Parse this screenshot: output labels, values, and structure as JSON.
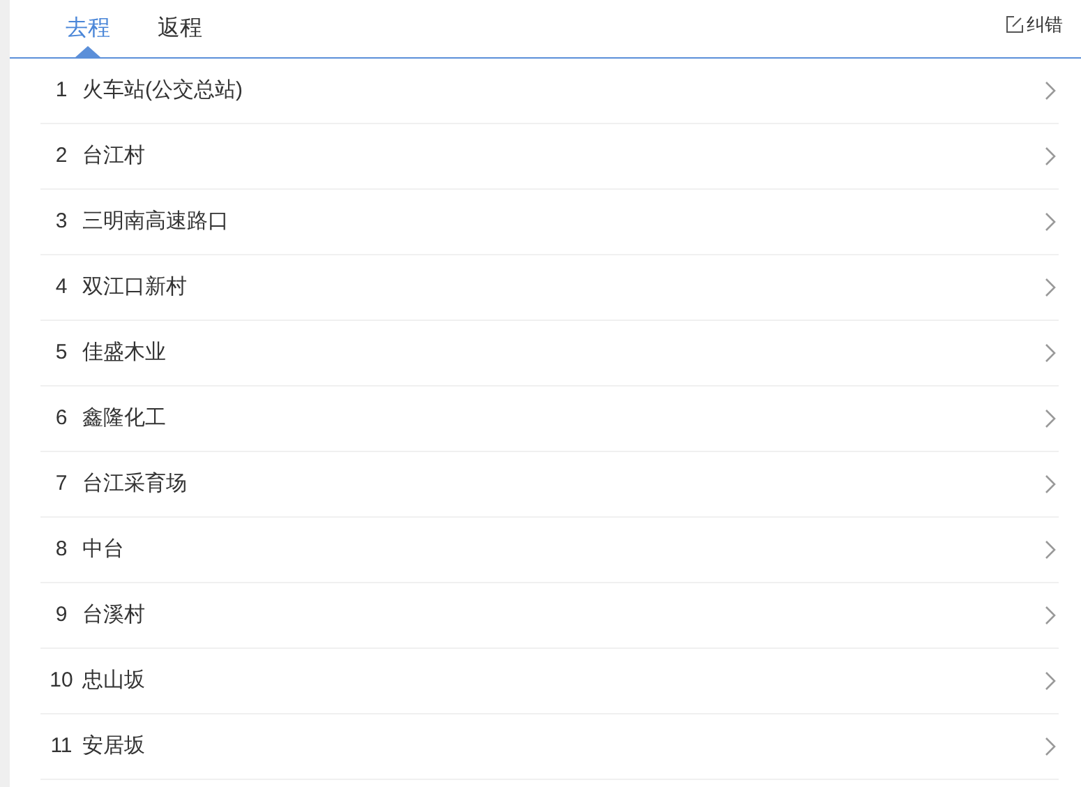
{
  "tabs": [
    {
      "label": "去程",
      "selected": true
    },
    {
      "label": "返程",
      "selected": false
    }
  ],
  "report_link": "纠错",
  "stops": [
    {
      "number": "1",
      "name": "火车站(公交总站)"
    },
    {
      "number": "2",
      "name": "台江村"
    },
    {
      "number": "3",
      "name": "三明南高速路口"
    },
    {
      "number": "4",
      "name": "双江口新村"
    },
    {
      "number": "5",
      "name": "佳盛木业"
    },
    {
      "number": "6",
      "name": "鑫隆化工"
    },
    {
      "number": "7",
      "name": "台江采育场"
    },
    {
      "number": "8",
      "name": "中台"
    },
    {
      "number": "9",
      "name": "台溪村"
    },
    {
      "number": "10",
      "name": "忠山坂"
    },
    {
      "number": "11",
      "name": "安居坂"
    }
  ]
}
